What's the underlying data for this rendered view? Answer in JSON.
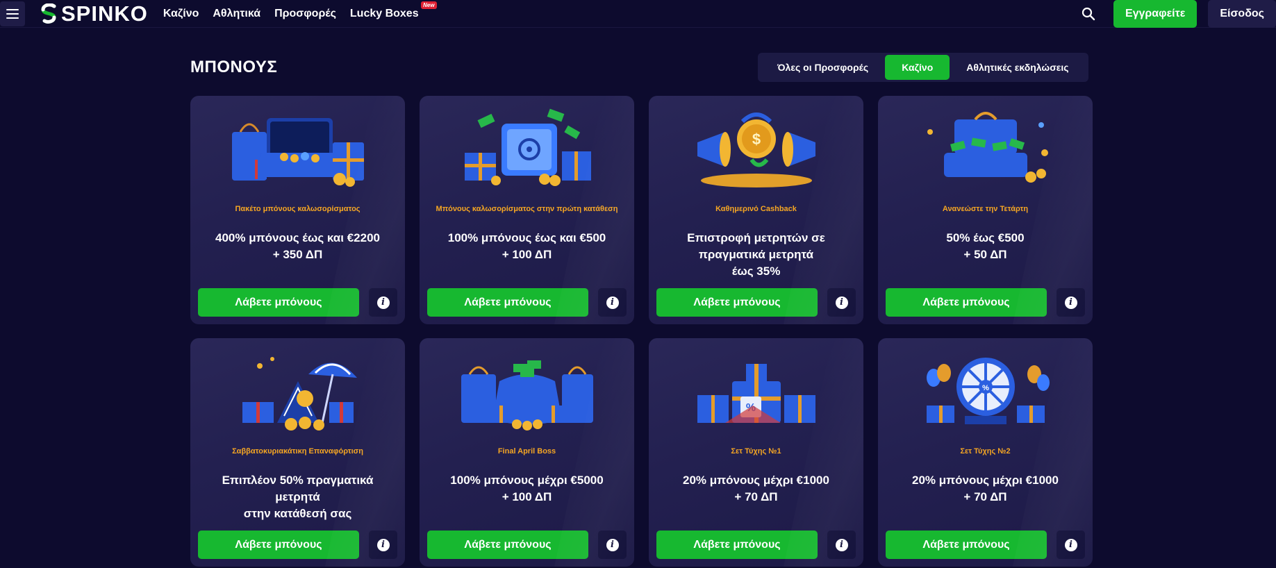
{
  "header": {
    "logo_text": "SPINKO",
    "nav": [
      {
        "label": "Καζίνο"
      },
      {
        "label": "Αθλητικά"
      },
      {
        "label": "Προσφορές"
      },
      {
        "label": "Lucky Boxes",
        "badge": "New"
      }
    ],
    "register_label": "Εγγραφείτε",
    "login_label": "Είσοδος"
  },
  "section": {
    "title": "ΜΠΟΝΟΥΣ",
    "tabs": [
      {
        "label": "Όλες οι Προσφορές",
        "active": false
      },
      {
        "label": "Καζίνο",
        "active": true
      },
      {
        "label": "Αθλητικές εκδηλώσεις",
        "active": false
      }
    ]
  },
  "cards": [
    {
      "subtitle": "Πακέτο μπόνους καλωσορίσματος",
      "main": "400% μπόνους έως και €2200\n+ 350 ΔΠ",
      "cta": "Λάβετε μπόνους",
      "art": "suitcase-gifts"
    },
    {
      "subtitle": "Μπόνους καλωσορίσματος στην πρώτη κατάθεση",
      "main": "100% μπόνους έως και €500\n+ 100 ΔΠ",
      "cta": "Λάβετε μπόνους",
      "art": "safe-money"
    },
    {
      "subtitle": "Καθημερινό Cashback",
      "main": "Επιστροφή μετρητών σε\nπραγματικά μετρητά\nέως 35%",
      "cta": "Λάβετε μπόνους",
      "art": "megaphone-coin"
    },
    {
      "subtitle": "Ανανεώστε την Τετάρτη",
      "main": "50% έως €500\n+ 50 ΔΠ",
      "cta": "Λάβετε μπόνους",
      "art": "cash-suitcase"
    },
    {
      "subtitle": "Σαββατοκυριακάτικη Επαναφόρτιση",
      "main": "Επιπλέον 50% πραγματικά\nμετρητά\nστην κατάθεσή σας",
      "cta": "Λάβετε μπόνους",
      "art": "beach-chair"
    },
    {
      "subtitle": "Final April Boss",
      "main": "100% μπόνους μέχρι €5000\n+ 100 ΔΠ",
      "cta": "Λάβετε μπόνους",
      "art": "money-bag"
    },
    {
      "subtitle": "Σετ Τύχης №1",
      "main": "20% μπόνους μέχρι €1000\n+ 70 ΔΠ",
      "cta": "Λάβετε μπόνους",
      "art": "gift-boxes"
    },
    {
      "subtitle": "Σετ Τύχης №2",
      "main": "20% μπόνους μέχρι €1000\n+ 70 ΔΠ",
      "cta": "Λάβετε μπόνους",
      "art": "fortune-wheel"
    }
  ],
  "colors": {
    "accent": "#17b830",
    "subtitle": "#f5a623",
    "background": "#0d0b2e"
  }
}
